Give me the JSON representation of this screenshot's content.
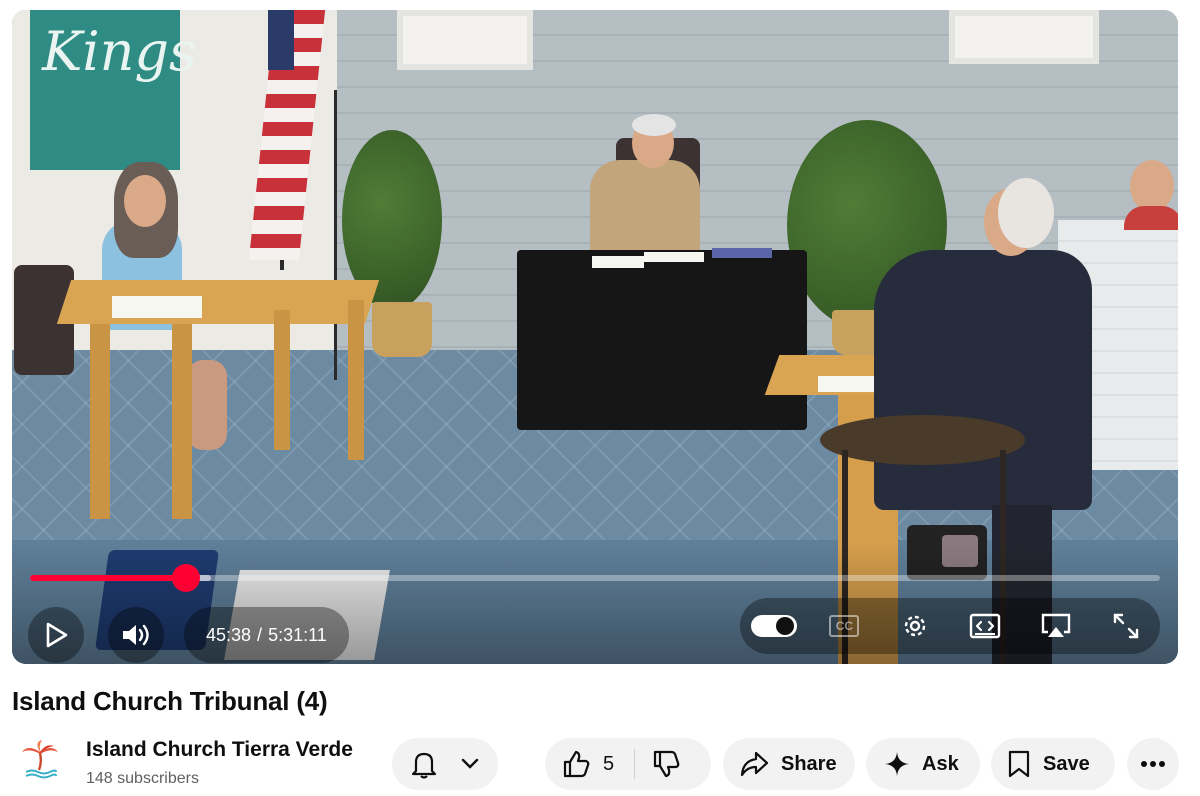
{
  "video": {
    "current_time": "45:38",
    "separator": "/",
    "duration": "5:31:11",
    "progress_fraction": 0.1377,
    "buffered_fraction": 0.16,
    "banner_text": "Kings",
    "cc_label": "CC"
  },
  "colors": {
    "accent_red": "#ff0033",
    "pill_bg": "#f2f2f2",
    "secondary_text": "#606060"
  },
  "meta": {
    "title": "Island Church Tribunal (4)",
    "channel": {
      "name": "Island Church Tierra Verde",
      "subscribers": "148 subscribers",
      "avatar_icon": "palm-tree-logo"
    }
  },
  "actions": {
    "like_count": "5",
    "share_label": "Share",
    "ask_label": "Ask",
    "save_label": "Save"
  }
}
